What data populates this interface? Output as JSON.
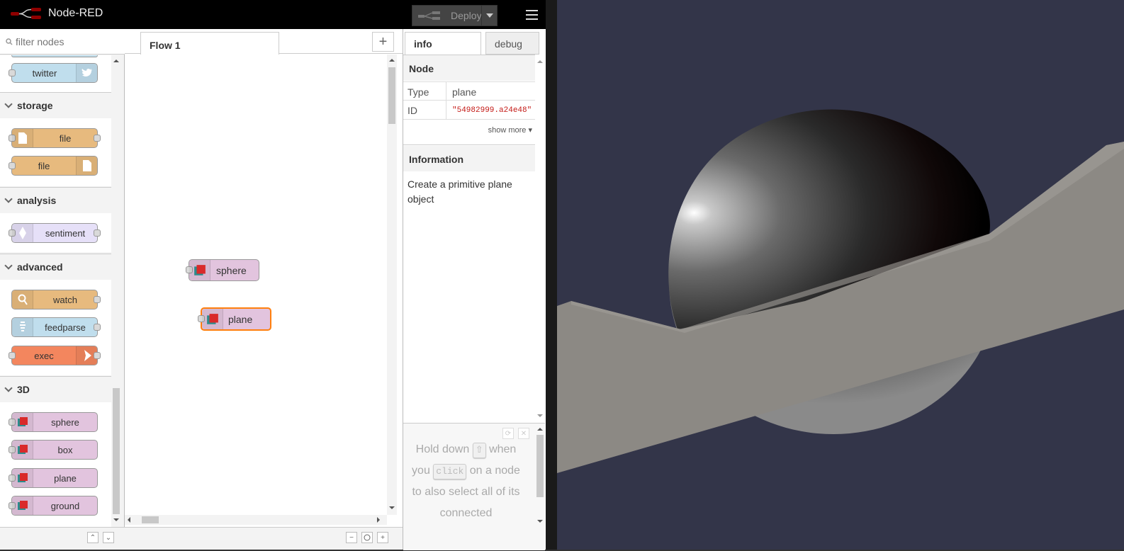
{
  "app": {
    "title": "Node-RED",
    "deploy_label": "Deploy"
  },
  "palette": {
    "search_placeholder": "filter nodes",
    "categories": [
      {
        "name": "storage",
        "nodes": [
          {
            "label": "file"
          },
          {
            "label": "file"
          }
        ]
      },
      {
        "name": "analysis",
        "nodes": [
          {
            "label": "sentiment"
          }
        ]
      },
      {
        "name": "advanced",
        "nodes": [
          {
            "label": "watch"
          },
          {
            "label": "feedparse"
          },
          {
            "label": "exec"
          }
        ]
      },
      {
        "name": "3D",
        "nodes": [
          {
            "label": "sphere"
          },
          {
            "label": "box"
          },
          {
            "label": "plane"
          },
          {
            "label": "ground"
          }
        ]
      }
    ],
    "partial_node": "twitter"
  },
  "workspace": {
    "tab": "Flow 1",
    "nodes": [
      {
        "label": "sphere"
      },
      {
        "label": "plane",
        "selected": true
      }
    ]
  },
  "sidebar": {
    "tabs": [
      "info",
      "debug"
    ],
    "node_section": "Node",
    "props": [
      {
        "key": "Type",
        "value": "plane"
      },
      {
        "key": "ID",
        "value": "\"54982999.a24e48\""
      }
    ],
    "show_more": "show more",
    "info_section": "Information",
    "info_text": "Create a primitive plane object",
    "tip": {
      "part1": "Hold down",
      "key1": "⇧",
      "part2": "when you",
      "key2": "click",
      "part3": "on a node to also select all of its connected"
    }
  },
  "colors": {
    "header": "#000000",
    "node_3d": "#e2c4de",
    "selected": "#ff7f0e",
    "scene_bg": "#333549"
  }
}
